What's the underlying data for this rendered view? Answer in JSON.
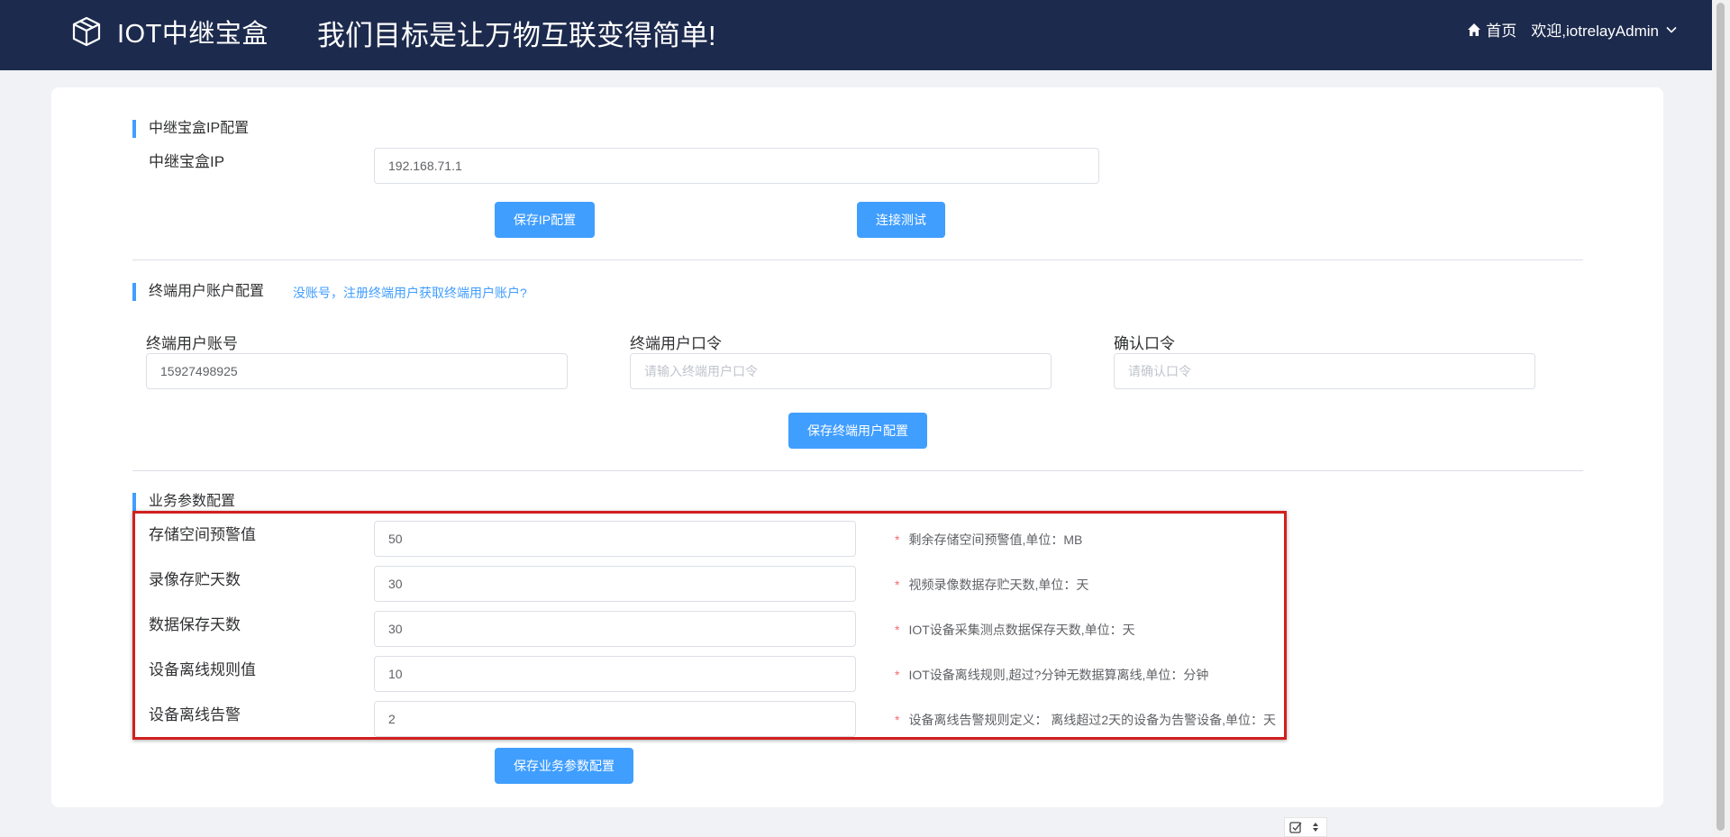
{
  "header": {
    "brand": "IOT中继宝盒",
    "slogan": "我们目标是让万物互联变得简单!",
    "home_label": "首页",
    "user_label": "欢迎,iotrelayAdmin"
  },
  "ip_section": {
    "title": "中继宝盒IP配置",
    "ip_label": "中继宝盒IP",
    "ip_value": "192.168.71.1",
    "save_button": "保存IP配置",
    "test_button": "连接测试"
  },
  "account_section": {
    "title": "终端用户账户配置",
    "register_link": "没账号，注册终端用户获取终端用户账户?",
    "account_label": "终端用户账号",
    "account_value": "15927498925",
    "password_label": "终端用户口令",
    "password_placeholder": "请输入终端用户口令",
    "confirm_label": "确认口令",
    "confirm_placeholder": "请确认口令",
    "save_button": "保存终端用户配置"
  },
  "business_section": {
    "title": "业务参数配置",
    "fields": [
      {
        "label": "存储空间预警值",
        "value": "50",
        "hint": "剩余存储空间预警值,单位：MB"
      },
      {
        "label": "录像存贮天数",
        "value": "30",
        "hint": "视频录像数据存贮天数,单位：天"
      },
      {
        "label": "数据保存天数",
        "value": "30",
        "hint": "IOT设备采集测点数据保存天数,单位：天"
      },
      {
        "label": "设备离线规则值",
        "value": "10",
        "hint": "IOT设备离线规则,超过?分钟无数据算离线,单位：分钟"
      },
      {
        "label": "设备离线告警",
        "value": "2",
        "hint": "设备离线告警规则定义： 离线超过2天的设备为告警设备,单位：天"
      }
    ],
    "required_mark": "*",
    "save_button": "保存业务参数配置"
  },
  "colors": {
    "header_bg": "#1c2a4d",
    "accent": "#409eff",
    "highlight_border": "#d21f1f",
    "required": "#f56c6c"
  },
  "icons": [
    "cube-logo-icon",
    "home-icon",
    "chevron-down-icon",
    "checkbox-icon",
    "sort-arrows-icon"
  ]
}
